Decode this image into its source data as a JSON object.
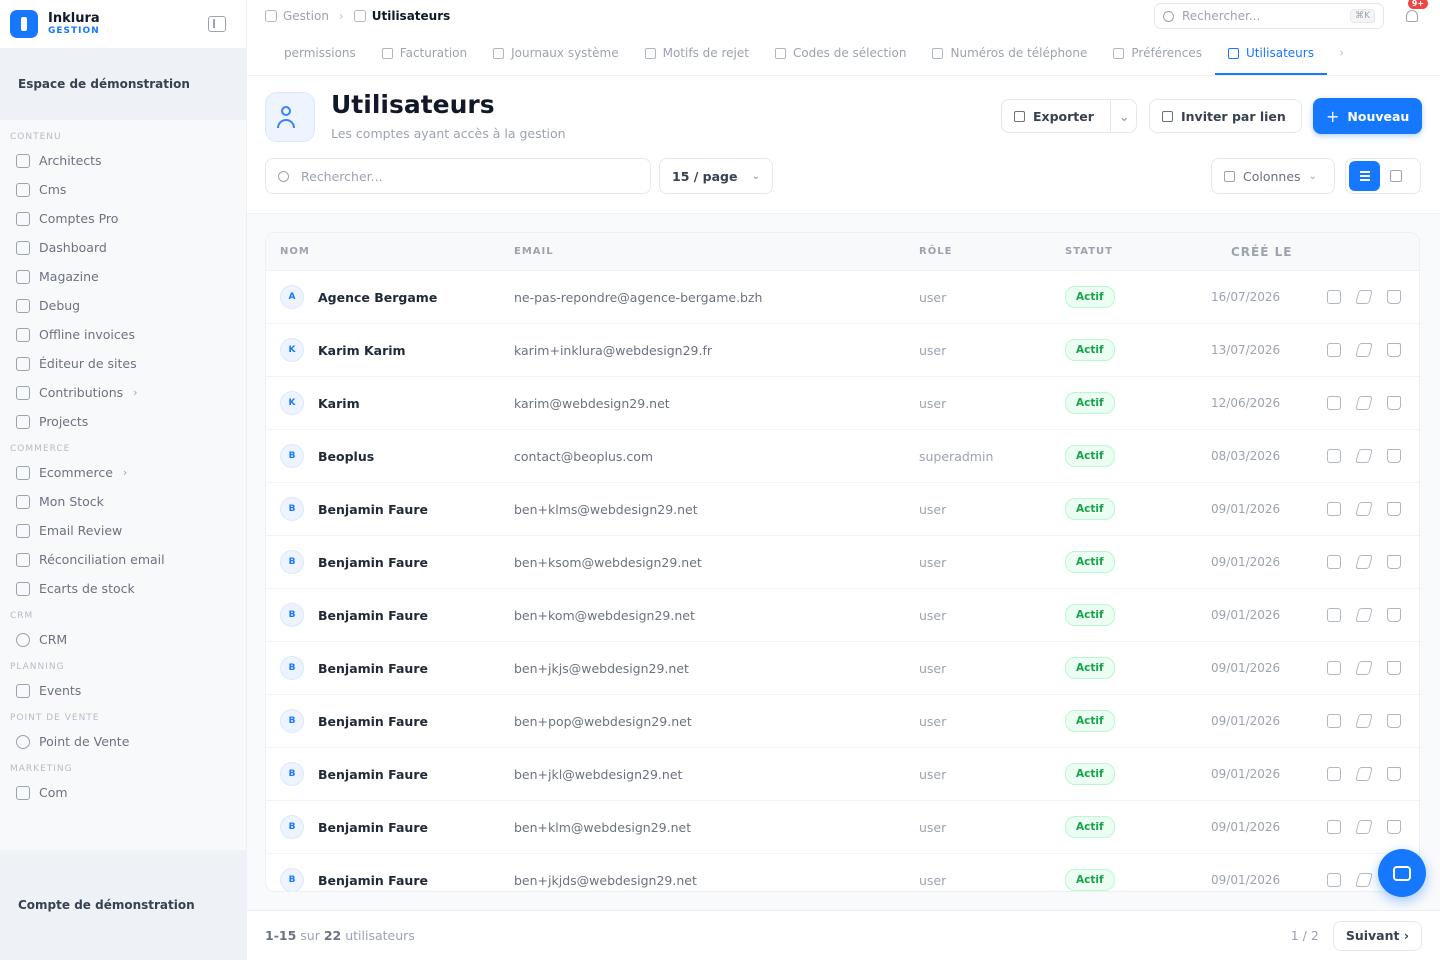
{
  "brand": {
    "name": "Inklura",
    "sub": "GESTION"
  },
  "workspace": "Espace de démonstration",
  "account": "Compte de démonstration",
  "sidebar": {
    "sections": [
      {
        "title": "CONTENU",
        "items": [
          {
            "label": "Architects",
            "icon": "file-icon"
          },
          {
            "label": "Cms",
            "icon": "file-icon"
          },
          {
            "label": "Comptes Pro",
            "icon": "file-icon"
          },
          {
            "label": "Dashboard",
            "icon": "grid-icon"
          },
          {
            "label": "Magazine",
            "icon": "book-icon"
          },
          {
            "label": "Debug",
            "icon": "book-icon"
          },
          {
            "label": "Offline invoices",
            "icon": "book-icon"
          },
          {
            "label": "Éditeur de sites",
            "icon": "terminal-icon"
          },
          {
            "label": "Contributions",
            "icon": "database-icon",
            "chevron": true
          },
          {
            "label": "Projects",
            "icon": "folder-icon"
          }
        ]
      },
      {
        "title": "COMMERCE",
        "items": [
          {
            "label": "Ecommerce",
            "icon": "cart-icon",
            "chevron": true
          },
          {
            "label": "Mon Stock",
            "icon": "cart-icon"
          },
          {
            "label": "Email Review",
            "icon": "cart-icon"
          },
          {
            "label": "Réconciliation email",
            "icon": "cart-icon"
          },
          {
            "label": "Ecarts de stock",
            "icon": "cart-icon"
          }
        ]
      },
      {
        "title": "CRM",
        "items": [
          {
            "label": "CRM",
            "icon": "user-icon"
          }
        ]
      },
      {
        "title": "PLANNING",
        "items": [
          {
            "label": "Events",
            "icon": "calendar-icon"
          }
        ]
      },
      {
        "title": "POINT DE VENTE",
        "items": [
          {
            "label": "Point de Vente",
            "icon": "register-icon"
          }
        ]
      },
      {
        "title": "MARKETING",
        "items": [
          {
            "label": "Com",
            "icon": "megaphone-icon"
          }
        ]
      }
    ]
  },
  "breadcrumb": {
    "root": "Gestion",
    "sep": "›",
    "current": "Utilisateurs"
  },
  "topsearch": {
    "placeholder": "Rechercher...",
    "kbd": "⌘K"
  },
  "notifications": {
    "count": "9+"
  },
  "tabs": [
    {
      "label": "permissions",
      "icon": ""
    },
    {
      "label": "Facturation",
      "icon": "card-icon"
    },
    {
      "label": "Journaux système",
      "icon": "file-icon"
    },
    {
      "label": "Motifs de rejet",
      "icon": "list-icon"
    },
    {
      "label": "Codes de sélection",
      "icon": "tag-icon"
    },
    {
      "label": "Numéros de téléphone",
      "icon": "message-icon"
    },
    {
      "label": "Préférences",
      "icon": "user-icon"
    },
    {
      "label": "Utilisateurs",
      "icon": "users-icon",
      "active": true
    }
  ],
  "page": {
    "title": "Utilisateurs",
    "subtitle": "Les comptes ayant accès à la gestion",
    "export_label": "Exporter",
    "invite_label": "Inviter par lien",
    "new_label": "Nouveau",
    "search_placeholder": "Rechercher...",
    "perpage": "15 / page",
    "columns_label": "Colonnes"
  },
  "table": {
    "headers": {
      "name": "NOM",
      "email": "EMAIL",
      "role": "RÔLE",
      "status": "STATUT",
      "created": "CRÉÉ LE"
    },
    "rows": [
      {
        "initial": "A",
        "name": "Agence Bergame",
        "email": "ne-pas-repondre@agence-bergame.bzh",
        "role": "user",
        "status": "Actif",
        "created": "16/07/2026"
      },
      {
        "initial": "K",
        "name": "Karim Karim",
        "email": "karim+inklura@webdesign29.fr",
        "role": "user",
        "status": "Actif",
        "created": "13/07/2026"
      },
      {
        "initial": "K",
        "name": "Karim",
        "email": "karim@webdesign29.net",
        "role": "user",
        "status": "Actif",
        "created": "12/06/2026"
      },
      {
        "initial": "B",
        "name": "Beoplus",
        "email": "contact@beoplus.com",
        "role": "superadmin",
        "status": "Actif",
        "created": "08/03/2026"
      },
      {
        "initial": "B",
        "name": "Benjamin Faure",
        "email": "ben+klms@webdesign29.net",
        "role": "user",
        "status": "Actif",
        "created": "09/01/2026"
      },
      {
        "initial": "B",
        "name": "Benjamin Faure",
        "email": "ben+ksom@webdesign29.net",
        "role": "user",
        "status": "Actif",
        "created": "09/01/2026"
      },
      {
        "initial": "B",
        "name": "Benjamin Faure",
        "email": "ben+kom@webdesign29.net",
        "role": "user",
        "status": "Actif",
        "created": "09/01/2026"
      },
      {
        "initial": "B",
        "name": "Benjamin Faure",
        "email": "ben+jkjs@webdesign29.net",
        "role": "user",
        "status": "Actif",
        "created": "09/01/2026"
      },
      {
        "initial": "B",
        "name": "Benjamin Faure",
        "email": "ben+pop@webdesign29.net",
        "role": "user",
        "status": "Actif",
        "created": "09/01/2026"
      },
      {
        "initial": "B",
        "name": "Benjamin Faure",
        "email": "ben+jkl@webdesign29.net",
        "role": "user",
        "status": "Actif",
        "created": "09/01/2026"
      },
      {
        "initial": "B",
        "name": "Benjamin Faure",
        "email": "ben+klm@webdesign29.net",
        "role": "user",
        "status": "Actif",
        "created": "09/01/2026"
      },
      {
        "initial": "B",
        "name": "Benjamin Faure",
        "email": "ben+jkjds@webdesign29.net",
        "role": "user",
        "status": "Actif",
        "created": "09/01/2026"
      }
    ]
  },
  "footer": {
    "range": "1-15",
    "of": "sur",
    "total": "22",
    "unit": "utilisateurs",
    "page_indicator": "1 / 2",
    "next_label": "Suivant"
  },
  "colors": {
    "accent": "#1677ff",
    "success": "#16a34a",
    "danger": "#ef4444"
  }
}
